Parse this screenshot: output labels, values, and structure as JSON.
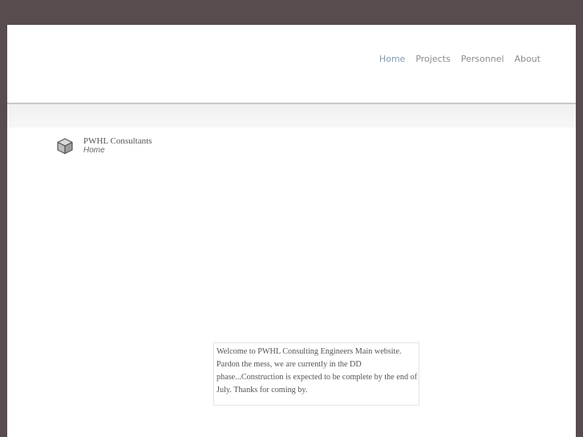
{
  "nav": {
    "items": [
      {
        "label": "Home",
        "active": true
      },
      {
        "label": "Projects",
        "active": false
      },
      {
        "label": "Personnel",
        "active": false
      },
      {
        "label": "About",
        "active": false
      }
    ]
  },
  "brand": {
    "icon": "cube-icon",
    "name": "PWHL Consultants",
    "breadcrumb": "Home"
  },
  "welcome": {
    "text": "Welcome to PWHL Consulting Engineers Main website. Pardon the mess, we are currently in the DD phase...Construction is expected to be complete by the end of July. Thanks for coming by."
  },
  "colors": {
    "frame": "#574c4e",
    "nav_active": "#7f9ab5",
    "nav_text": "#8c8c8c"
  }
}
